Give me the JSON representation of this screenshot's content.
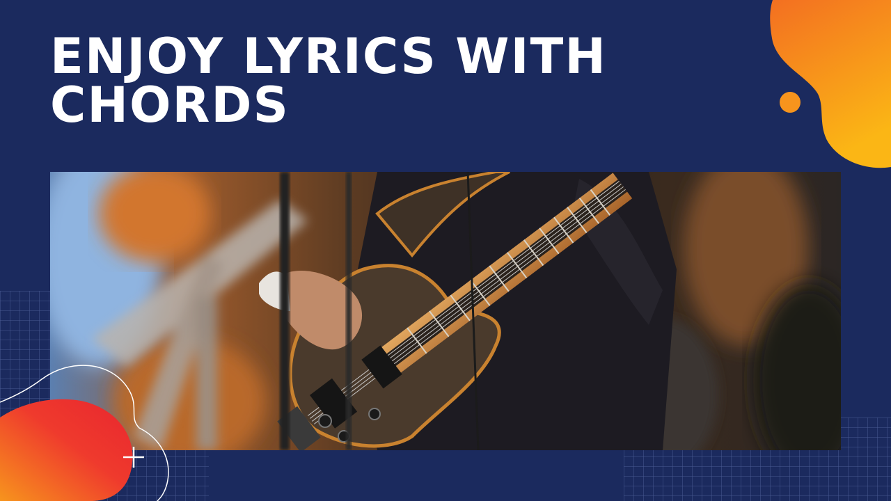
{
  "headline": {
    "line1": "ENJOY LYRICS WITH",
    "line2": "CHORDS"
  },
  "colors": {
    "background": "#1b2a5e",
    "headline_text": "#ffffff",
    "accent_orange": "#f7941d",
    "accent_red": "#ef3a2d",
    "accent_yellow": "#fbb615"
  },
  "photo": {
    "subject": "bass-guitar-player-photo"
  },
  "decor": {
    "plus_icon": "plus-icon"
  }
}
